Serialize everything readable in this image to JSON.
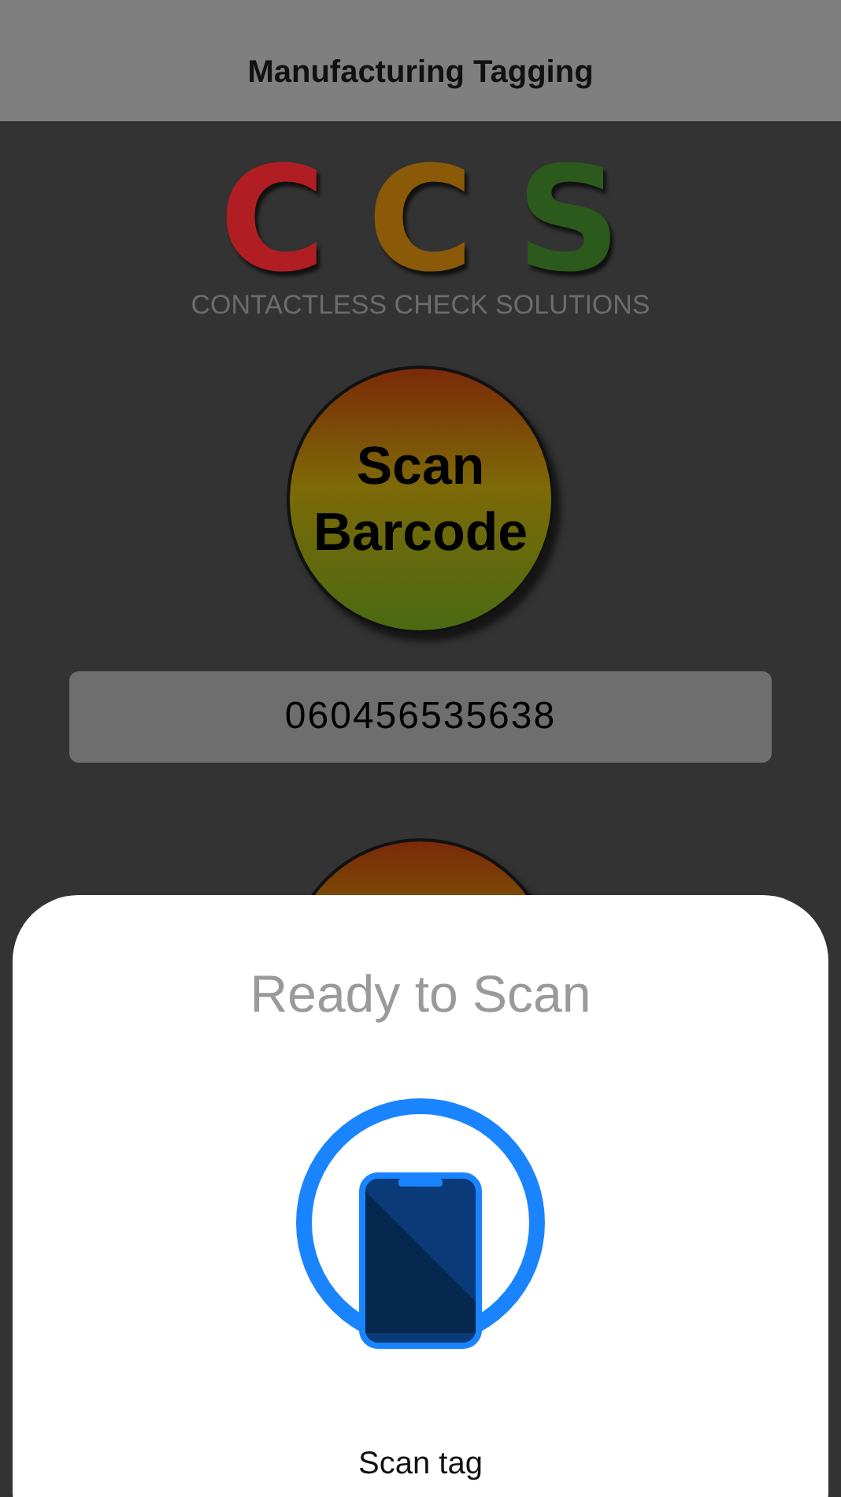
{
  "nav_bar": {
    "title": "Manufacturing Tagging"
  },
  "logo": {
    "letters": [
      {
        "char": "C",
        "color": "#b01e24"
      },
      {
        "char": "C",
        "color": "#8a5a08"
      },
      {
        "char": "S",
        "color": "#2c5a1c"
      }
    ],
    "tagline": "CONTACTLESS CHECK SOLUTIONS"
  },
  "scan_barcode_button": {
    "label": "Scan\nBarcode"
  },
  "barcode_field": {
    "value": "060456535638"
  },
  "nfc_sheet": {
    "title": "Ready to Scan",
    "message": "Scan tag"
  }
}
